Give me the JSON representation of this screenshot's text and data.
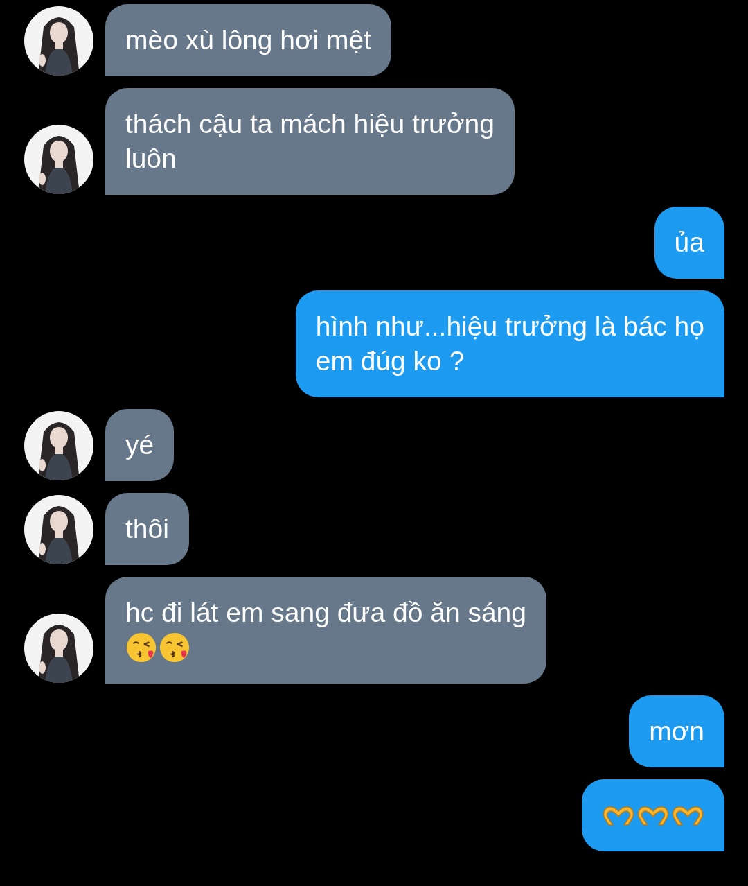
{
  "messages": [
    {
      "kind": "received",
      "lines": [
        "mèo xù lông hơi mệt"
      ]
    },
    {
      "kind": "received",
      "lines": [
        "thách cậu ta mách hiệu trưởng",
        "luôn"
      ]
    },
    {
      "kind": "sent",
      "lines": [
        "ủa"
      ]
    },
    {
      "kind": "sent",
      "lines": [
        "hình như...hiệu trưởng là bác họ",
        "em đúg ko ?"
      ]
    },
    {
      "kind": "received",
      "lines": [
        "yé"
      ]
    },
    {
      "kind": "received",
      "lines": [
        "thôi"
      ]
    },
    {
      "kind": "received",
      "lines": [
        "hc đi lát em sang đưa đồ ăn sáng"
      ],
      "emoji": [
        {
          "kind": "kiss"
        },
        {
          "kind": "kiss"
        }
      ]
    },
    {
      "kind": "sent",
      "lines": [
        "mơn"
      ]
    },
    {
      "kind": "sent",
      "emoji": [
        {
          "kind": "heart-hands"
        },
        {
          "kind": "heart-hands"
        },
        {
          "kind": "heart-hands"
        }
      ]
    }
  ]
}
